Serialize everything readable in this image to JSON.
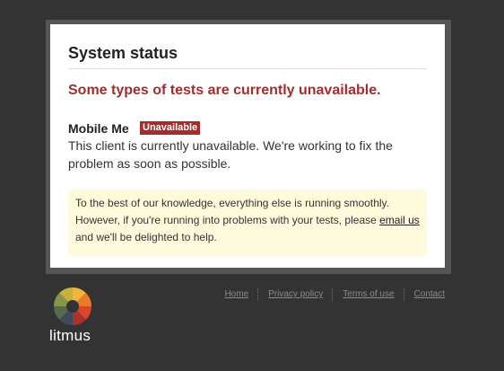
{
  "status": {
    "title": "System status",
    "alert": "Some types of tests are currently unavailable.",
    "client": {
      "name": "Mobile Me",
      "badge": "Unavailable",
      "description": "This client is currently unavailable. We're working to fix the problem as soon as possible."
    },
    "notice": {
      "text_before": "To the best of our knowledge, everything else is running smoothly. However, if you're running into problems with your tests, please ",
      "link_label": "email us",
      "text_after": " and we'll be delighted to help."
    }
  },
  "brand": {
    "name": "litmus",
    "icon": "litmus-wheel-icon"
  },
  "footer": {
    "links": [
      {
        "label": "Home"
      },
      {
        "label": "Privacy policy"
      },
      {
        "label": "Terms of use"
      },
      {
        "label": "Contact"
      }
    ]
  },
  "colors": {
    "background": "#333333",
    "frame": "#555555",
    "alert": "#a32d2d",
    "notice_bg": "#fefbdc",
    "footer_link": "#8a8a8a"
  }
}
